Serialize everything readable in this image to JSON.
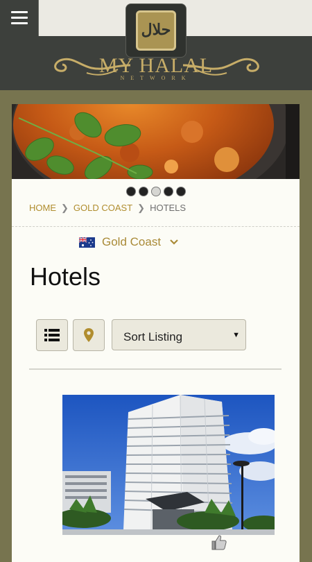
{
  "header": {
    "logo_arabic": "حلال",
    "logo_name": "MY HALAL",
    "logo_sub": "NETWORK",
    "menu_icon": "hamburger-menu-icon"
  },
  "carousel": {
    "slides": 5,
    "active_index": 2
  },
  "breadcrumb": {
    "home": "HOME",
    "city": "GOLD COAST",
    "current": "HOTELS"
  },
  "location": {
    "flag_icon": "australia-flag-icon",
    "label": "Gold Coast"
  },
  "page": {
    "title": "Hotels"
  },
  "toolbar": {
    "list_icon": "list-icon",
    "map_icon": "map-pin-icon",
    "sort_label": "Sort Listing"
  },
  "listing": {
    "like_icon": "thumbs-up-icon"
  },
  "colors": {
    "gold": "#b08d2e",
    "header_dark": "#3d403c",
    "page_bg": "#77744f",
    "card_bg": "#fcfcf6"
  }
}
